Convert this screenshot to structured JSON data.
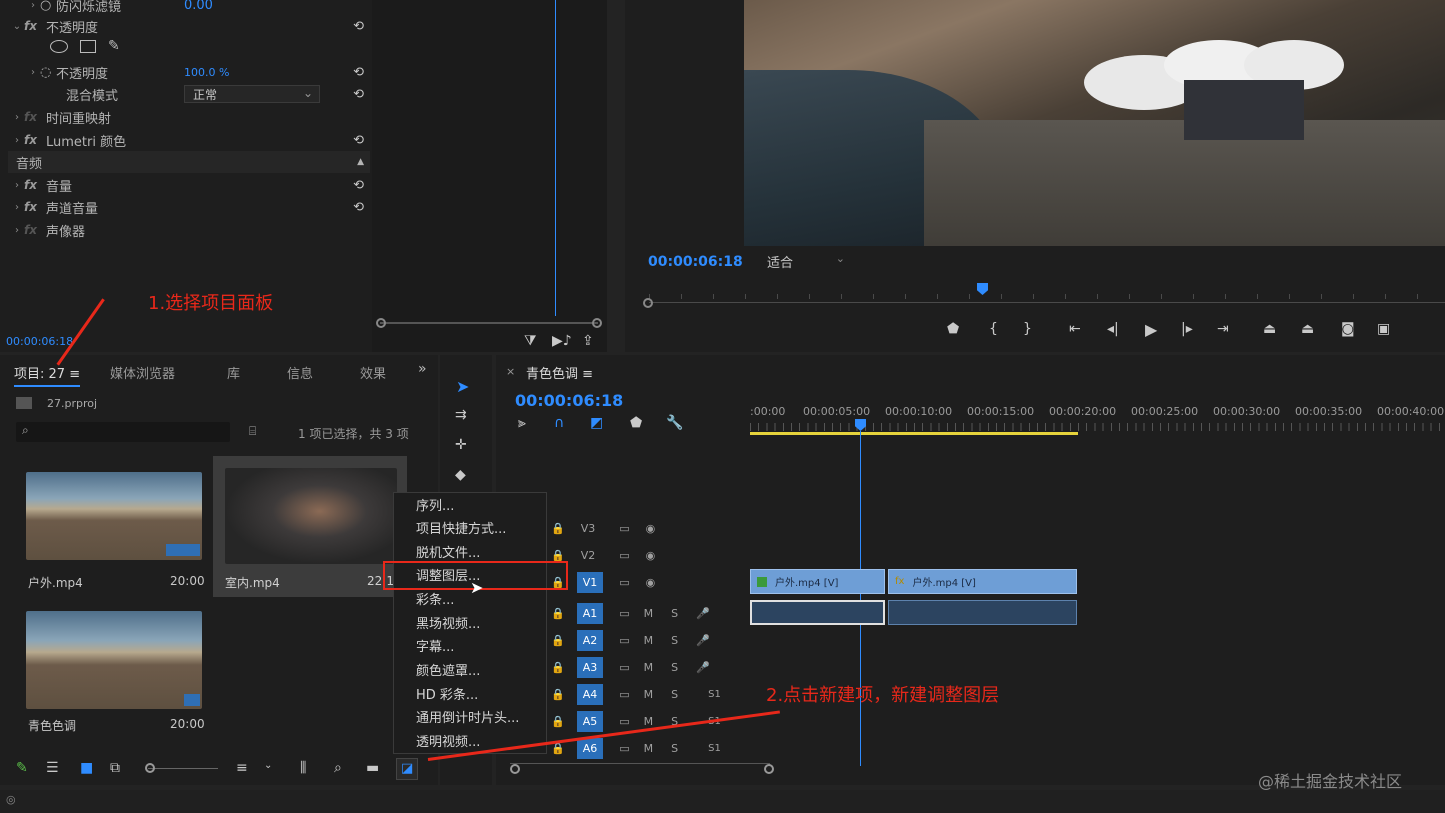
{
  "effect_controls": {
    "rows": [
      {
        "label": "防闪烁滤镜",
        "value": "0.00"
      },
      {
        "label": "不透明度"
      },
      {
        "label": "不透明度",
        "value": "100.0 %"
      },
      {
        "label": "混合模式",
        "value": "正常"
      },
      {
        "label": "时间重映射"
      },
      {
        "label": "Lumetri 颜色"
      },
      {
        "label": "音频"
      },
      {
        "label": "音量"
      },
      {
        "label": "声道音量"
      },
      {
        "label": "声像器"
      }
    ],
    "fx_label": "fx",
    "timecode": "00:00:06:18"
  },
  "program": {
    "timecode": "00:00:06:18",
    "fit": "适合"
  },
  "project": {
    "tabs": [
      "项目: 27",
      "媒体浏览器",
      "库",
      "信息",
      "效果"
    ],
    "file": "27.prproj",
    "selection_info": "1 项已选择，共 3 项",
    "items": [
      {
        "name": "户外.mp4",
        "duration": "20:00"
      },
      {
        "name": "室内.mp4",
        "duration": "22:1"
      },
      {
        "name": "青色色调",
        "duration": "20:00"
      }
    ]
  },
  "context_menu": {
    "items": [
      "序列...",
      "项目快捷方式...",
      "脱机文件...",
      "调整图层...",
      "彩条...",
      "黑场视频...",
      "字幕...",
      "颜色遮罩...",
      "HD 彩条...",
      "通用倒计时片头...",
      "透明视频..."
    ],
    "highlighted": "调整图层..."
  },
  "timeline": {
    "sequence_name": "青色色调",
    "timecode": "00:00:06:18",
    "ruler": [
      ":00:00",
      "00:00:05:00",
      "00:00:10:00",
      "00:00:15:00",
      "00:00:20:00",
      "00:00:25:00",
      "00:00:30:00",
      "00:00:35:00",
      "00:00:40:00"
    ],
    "video_tracks": [
      "V3",
      "V2",
      "V1"
    ],
    "audio_tracks": [
      "A1",
      "A2",
      "A3",
      "A4",
      "A5",
      "A6"
    ],
    "m_label": "M",
    "s_label": "S",
    "s1_label": "S1",
    "clips": [
      "户外.mp4 [V]",
      "户外.mp4 [V]"
    ],
    "fx_badge": "fx"
  },
  "annotations": {
    "step1": "1.选择项目面板",
    "step2": "2.点击新建项，新建调整图层"
  },
  "watermark": "@稀土掘金技术社区",
  "colors": {
    "accent": "#2f8cff",
    "annotation": "#e8281a",
    "clip": "#6e9ed6"
  }
}
